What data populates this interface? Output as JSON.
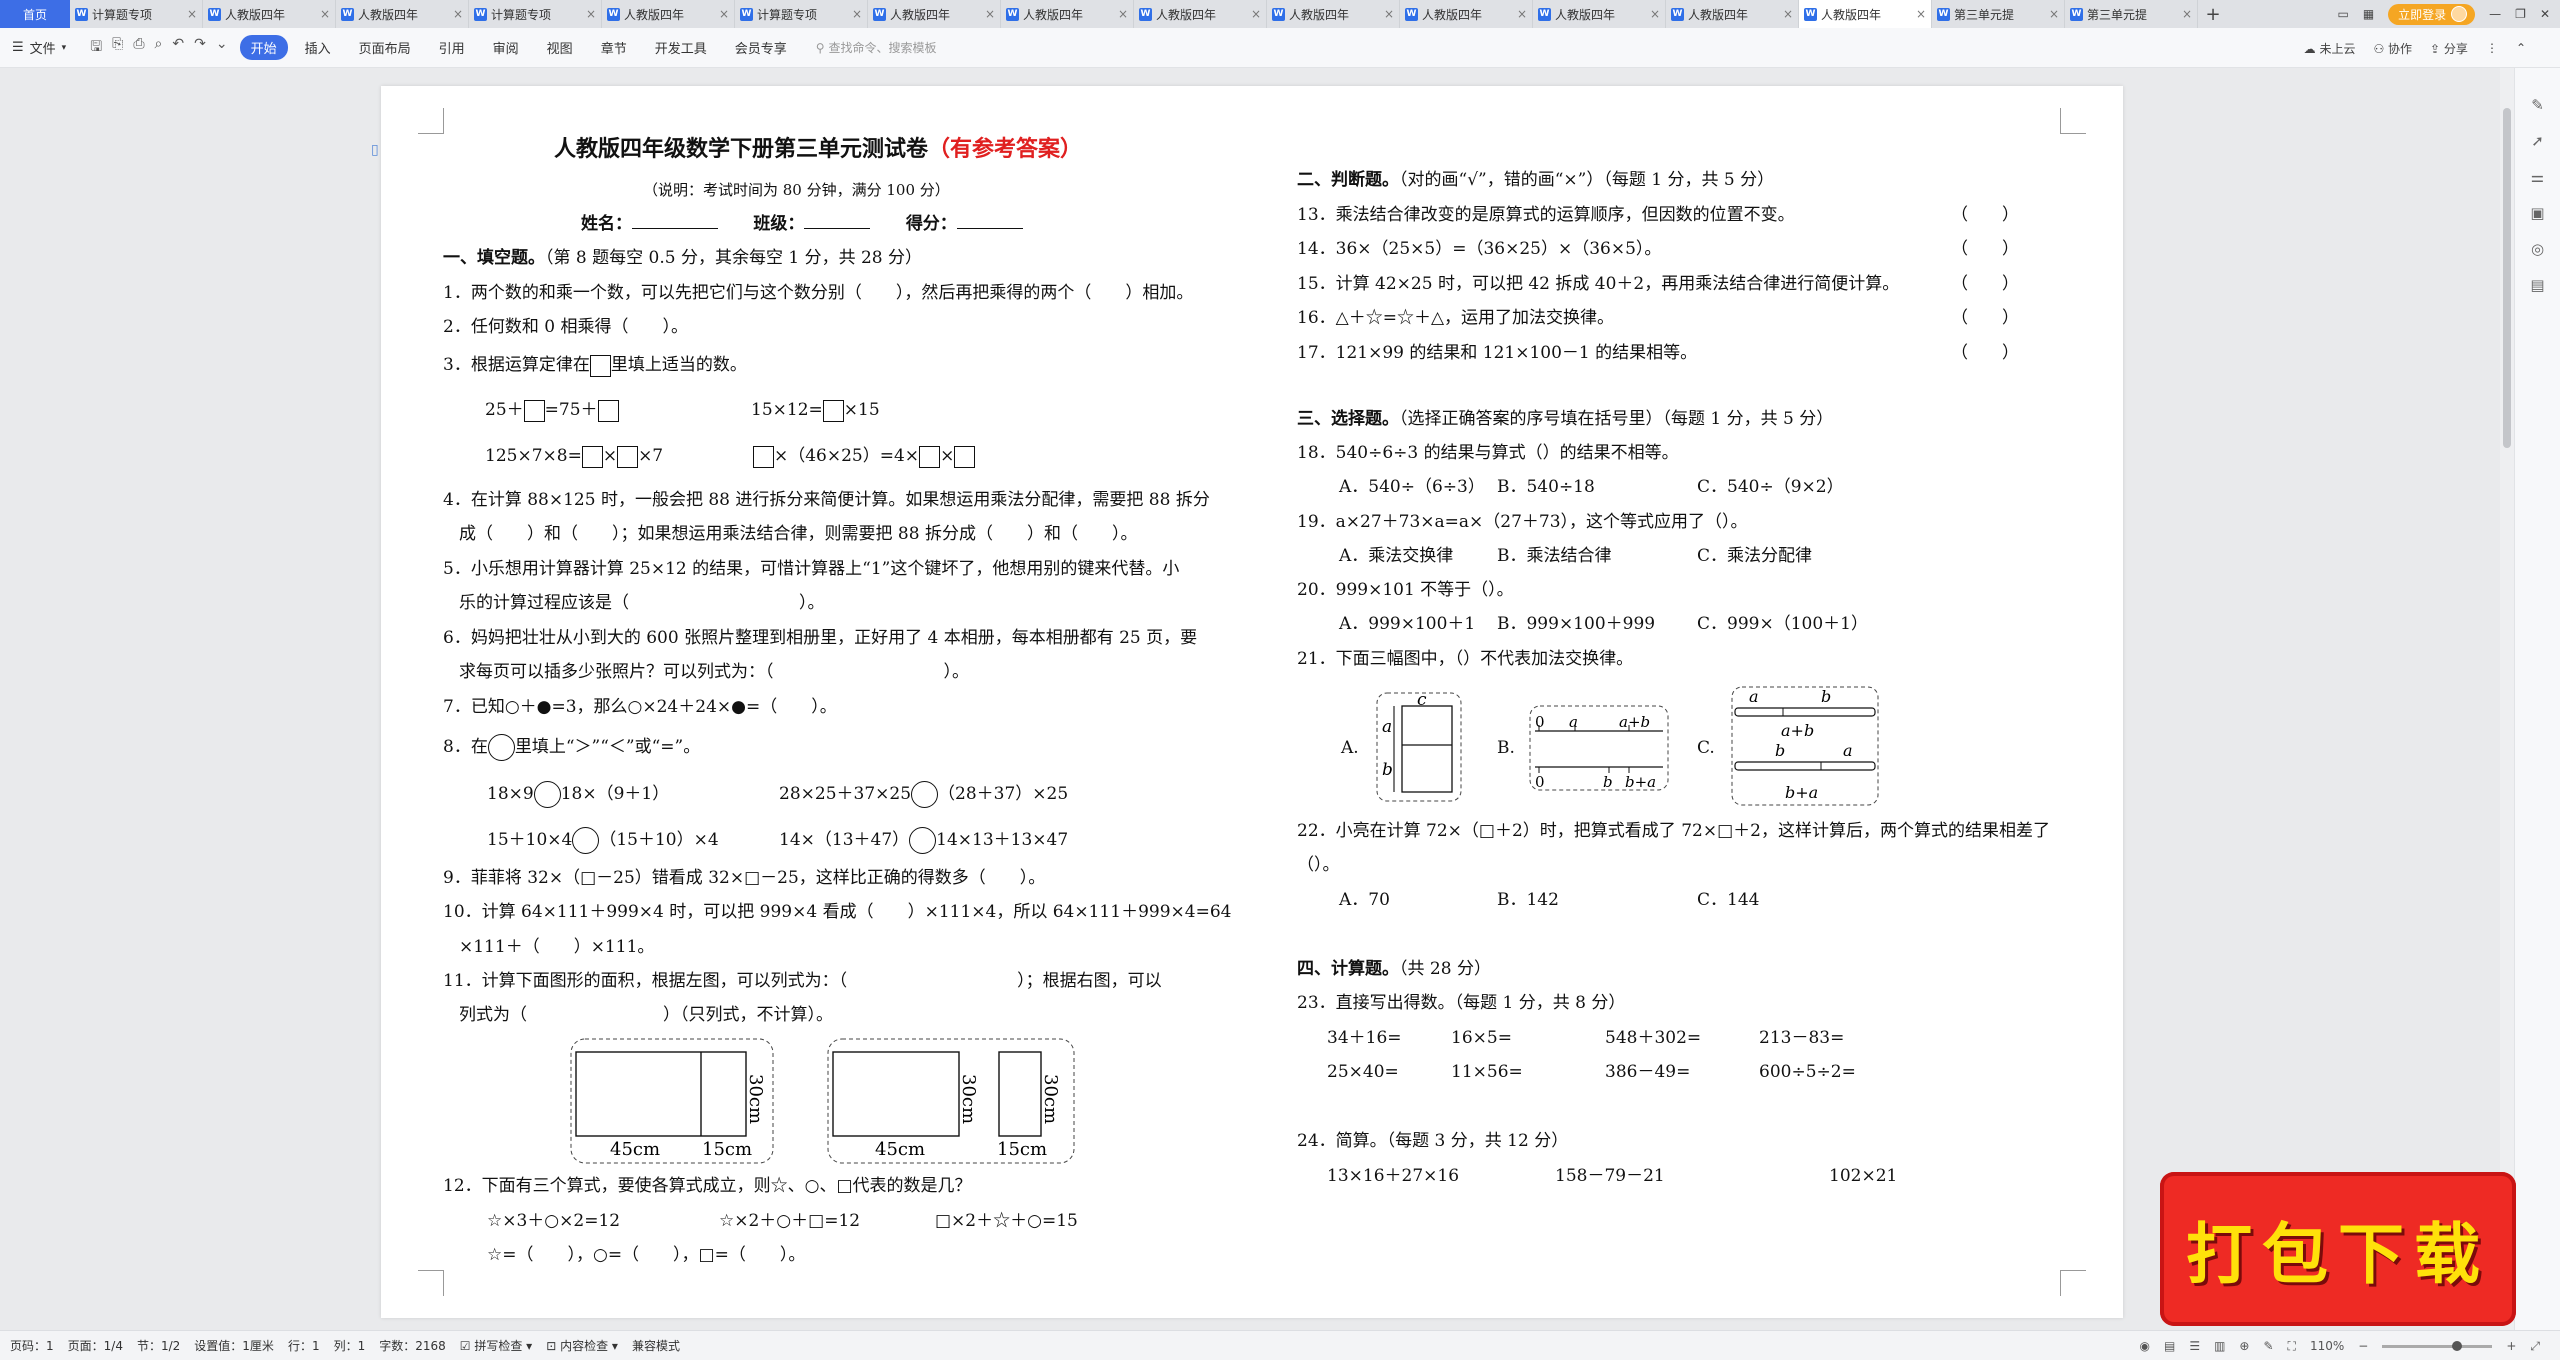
{
  "tabs": {
    "home": "首页",
    "docs": [
      "计算题专项",
      "人教版四年",
      "人教版四年",
      "计算题专项",
      "人教版四年",
      "计算题专项",
      "人教版四年",
      "人教版四年",
      "人教版四年",
      "人教版四年",
      "人教版四年",
      "人教版四年",
      "人教版四年",
      "人教版四年",
      "第三单元提",
      "第三单元提"
    ],
    "active_index": 13,
    "add": "+",
    "login": "立即登录"
  },
  "menu": {
    "file": "文件",
    "tabs": [
      "开始",
      "插入",
      "页面布局",
      "引用",
      "审阅",
      "视图",
      "章节",
      "开发工具",
      "会员专享"
    ],
    "active": "开始",
    "search_placeholder": "查找命令、搜索模板",
    "cloud": "未上云",
    "collab": "协作",
    "share": "分享"
  },
  "doc": {
    "title_main": "人教版四年级数学下册第三单元测试卷",
    "title_note": "（有参考答案）",
    "instruction": "（说明：考试时间为 80 分钟，满分 100 分）",
    "name_label": "姓名：",
    "class_label": "班级：",
    "score_label": "得分：",
    "s1_head": "一、填空题。",
    "s1_note": "（第 8 题每空 0.5 分，其余每空 1 分，共 28 分）",
    "q1": "1．两个数的和乘一个数，可以先把它们与这个数分别（　　），然后再把乘得的两个（　　）相加。",
    "q2": "2．任何数和 0 相乘得（　　）。",
    "q3a": "3．根据运算定律在",
    "q3b": "里填上适当的数。",
    "q3_r1a": "25＋",
    "q3_r1b": "=75＋",
    "q3_r1c": "15×12=",
    "q3_r1d": "×15",
    "q3_r2a": "125×7×8=",
    "q3_r2b": "×",
    "q3_r2c": "×7",
    "q3_r2d": "×（46×25）=4×",
    "q3_r2e": "×",
    "q4a": "4．在计算 88×125 时，一般会把 88 进行拆分来简便计算。如果想运用乘法分配律，需要把 88 拆分",
    "q4b": "成（　　）和（　　）；如果想运用乘法结合律，则需要把 88 拆分成（　　）和（　　）。",
    "q5a": "5．小乐想用计算器计算 25×12 的结果，可惜计算器上“1”这个键坏了，他想用别的键来代替。小",
    "q5b": "乐的计算过程应该是（　　　　　　　　　　）。",
    "q6a": "6．妈妈把壮壮从小到大的 600 张照片整理到相册里，正好用了 4 本相册，每本相册都有 25 页，要",
    "q6b": "求每页可以插多少张照片？可以列式为：（　　　　　　　　　　）。",
    "q7": "7．已知○＋●=3，那么○×24＋24×●=（　　）。",
    "q8a": "8．在",
    "q8b": "里填上“＞”“＜”或“=”。",
    "q8_1a": "18×9",
    "q8_1b": "18×（9＋1）",
    "q8_2a": "28×25＋37×25",
    "q8_2b": "（28＋37）×25",
    "q8_3a": "15＋10×4",
    "q8_3b": "（15＋10）×4",
    "q8_4a": "14×（13＋47）",
    "q8_4b": "14×13＋13×47",
    "q9": "9．菲菲将 32×（□－25）错看成 32×□－25，这样比正确的得数多（　　）。",
    "q10a": "10．计算 64×111＋999×4 时，可以把 999×4 看成（　　）×111×4，所以 64×111＋999×4=64",
    "q10b": "×111＋（　　）×111。",
    "q11a": "11．计算下面图形的面积，根据左图，可以列式为：（　　　　　　　　　　）；根据右图，可以",
    "q11b": "列式为（　　　　　　　　）（只列式，不计算）。",
    "fig11": {
      "w1": "45cm",
      "w2": "15cm",
      "h": "30cm"
    },
    "q12": "12．下面有三个算式，要使各算式成立，则☆、○、□代表的数是几？",
    "q12_e1": "☆×3＋○×2=12",
    "q12_e2": "☆×2＋○＋□=12",
    "q12_e3": "□×2＋☆＋○=15",
    "q12_ans": "☆=（　　），○=（　　），□=（　　）。",
    "s2_head": "二、判断题。",
    "s2_note": "（对的画“√”，错的画“×”）（每题 1 分，共 5 分）",
    "judge": [
      "13．乘法结合律改变的是原算式的运算顺序，但因数的位置不变。",
      "14．36×（25×5）=（36×25）×（36×5）。",
      "15．计算 42×25 时，可以把 42 拆成 40＋2，再用乘法结合律进行简便计算。",
      "16．△＋☆=☆＋△，运用了加法交换律。",
      "17．121×99 的结果和 121×100－1 的结果相等。"
    ],
    "judge_paren": "（　　）",
    "s3_head": "三、选择题。",
    "s3_note": "（选择正确答案的序号填在括号里）（每题 1 分，共 5 分）",
    "q18": "18．540÷6÷3 的结果与算式（）的结果不相等。",
    "q18_opts": [
      "A．540÷（6÷3）",
      "B．540÷18",
      "C．540÷（9×2）"
    ],
    "q19": "19．a×27＋73×a=a×（27＋73），这个等式应用了（）。",
    "q19_opts": [
      "A．乘法交换律",
      "B．乘法结合律",
      "C．乘法分配律"
    ],
    "q20": "20．999×101 不等于（）。",
    "q20_opts": [
      "A．999×100＋1",
      "B．999×100＋999",
      "C．999×（100＋1）"
    ],
    "q21": "21．下面三幅图中，（）不代表加法交换律。",
    "q21_labels": [
      "A.",
      "B.",
      "C."
    ],
    "q21_fig": {
      "a": "a",
      "b": "b",
      "c": "c",
      "zero": "0",
      "apb": "a+b",
      "bpa": "b+a"
    },
    "q22a": "22．小亮在计算 72×（□＋2）时，把算式看成了 72×□＋2，这样计算后，两个算式的结果相差了",
    "q22b": "（）。",
    "q22_opts": [
      "A．70",
      "B．142",
      "C．144"
    ],
    "s4_head": "四、计算题。",
    "s4_note": "（共 28 分）",
    "q23": "23．直接写出得数。（每题 1 分，共 8 分）",
    "q23_items": [
      "34＋16=",
      "16×5=",
      "548＋302=",
      "213－83=",
      "25×40=",
      "11×56=",
      "386－49=",
      "600÷5÷2="
    ],
    "q24": "24．简算。（每题 3 分，共 12 分）",
    "q24_items": [
      "13×16＋27×16",
      "158－79－21",
      "102×21"
    ]
  },
  "status": {
    "page_no": "页码：1",
    "pages": "页面：1/4",
    "section": "节：1/2",
    "setting": "设置值：1厘米",
    "row": "行：1",
    "col": "列：1",
    "words": "字数：2168",
    "spell": "拼写检查",
    "content_check": "内容检查",
    "compat": "兼容模式",
    "zoom": "110%"
  },
  "promo": {
    "text": "打包下载"
  },
  "colors": {
    "accent": "#3d6ee6",
    "title_red": "#e02020",
    "promo_bg": "#ee2a24",
    "promo_text": "#ffe10a"
  }
}
